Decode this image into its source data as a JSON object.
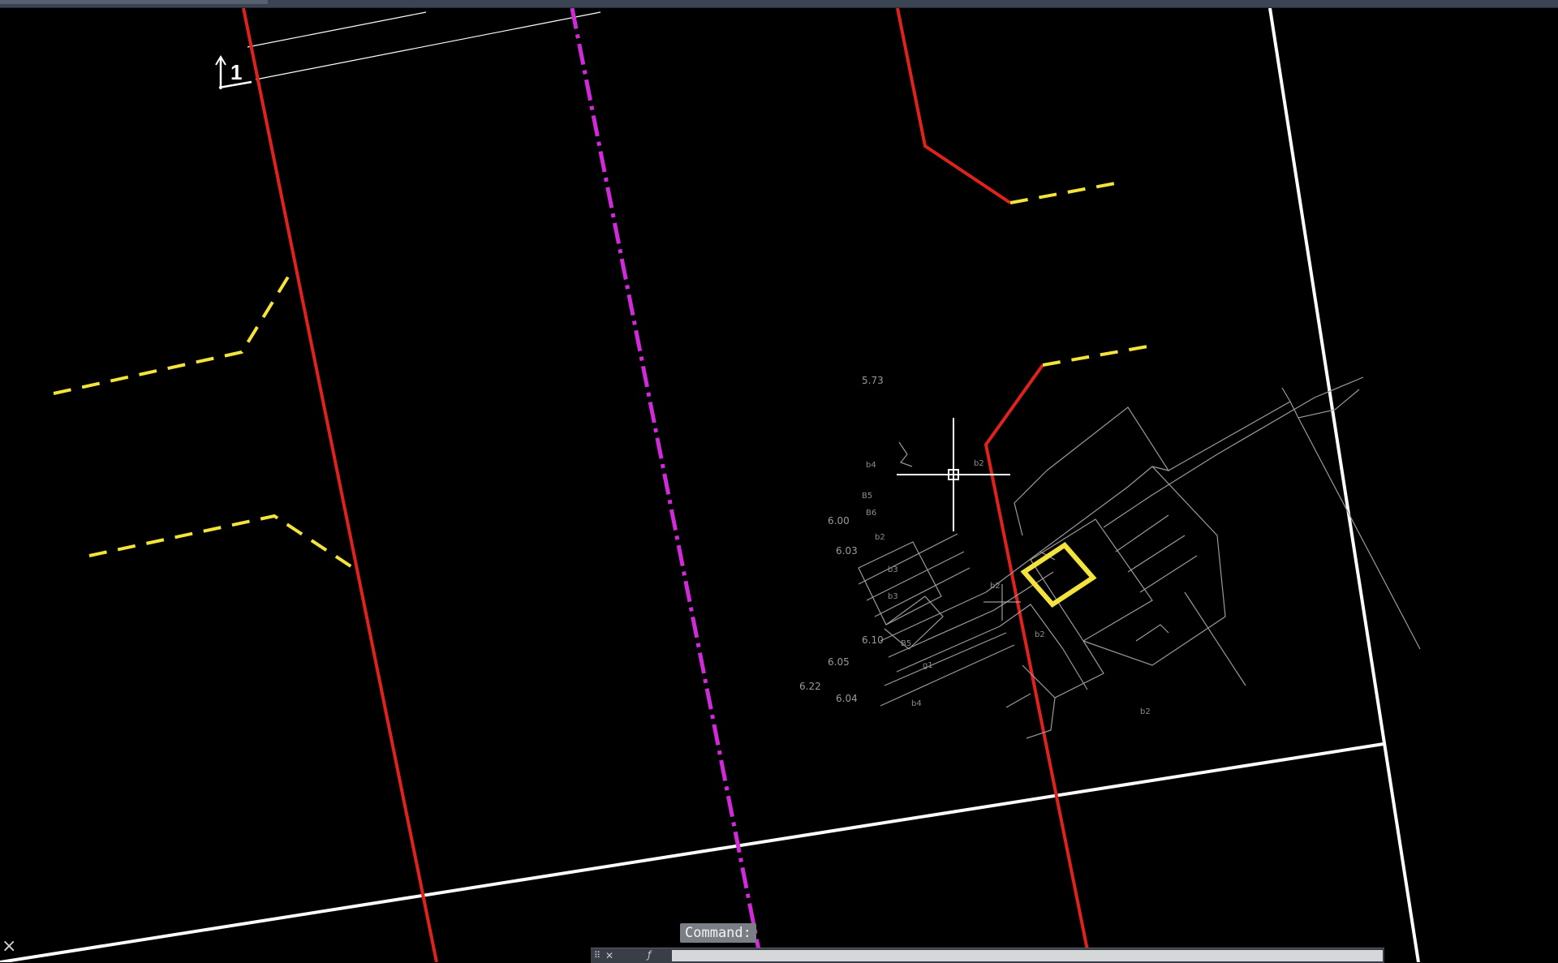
{
  "viewport": {
    "dimension_text": "1",
    "elevation_labels": [
      "5.73",
      "6.00",
      "6.03",
      "6.10",
      "6.05",
      "6.22",
      "6.04"
    ],
    "parcel_labels": [
      "b4",
      "B5",
      "B6",
      "b2",
      "b3",
      "b3",
      "B5",
      "g1",
      "b4",
      "b2",
      "b2",
      "b2",
      "b2"
    ],
    "colors": {
      "background": "#000000",
      "boundary": "#ffffff",
      "red_line": "#e0221c",
      "centerline": "#d12ad8",
      "dashed": "#f3e33b",
      "detail": "#9a9a9a",
      "highlight": "#f3e33b"
    }
  },
  "command_line": {
    "prompt": "Command:",
    "input_value": "",
    "input_placeholder": "",
    "grip_icon": "grip-icon",
    "close_icon": "close-icon",
    "fx_icon": "fx-icon"
  }
}
